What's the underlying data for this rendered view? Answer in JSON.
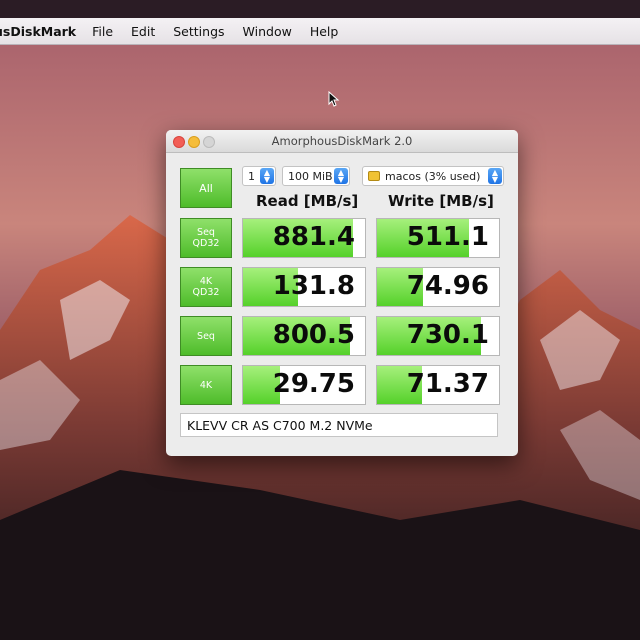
{
  "menubar": {
    "app_name": "usDiskMark",
    "items": [
      "File",
      "Edit",
      "Settings",
      "Window",
      "Help"
    ]
  },
  "window": {
    "title": "AmorphousDiskMark 2.0",
    "all_button": "All",
    "count_select": "1",
    "size_select": "100 MiB",
    "drive_select": "macos (3% used)",
    "read_header": "Read [MB/s]",
    "write_header": "Write [MB/s]",
    "rows": [
      {
        "label1": "Seq",
        "label2": "QD32",
        "read": "881.4",
        "write": "511.1",
        "read_fill": 0.9,
        "write_fill": 0.75
      },
      {
        "label1": "4K",
        "label2": "QD32",
        "read": "131.8",
        "write": "74.96",
        "read_fill": 0.45,
        "write_fill": 0.38
      },
      {
        "label1": "Seq",
        "label2": "",
        "read": "800.5",
        "write": "730.1",
        "read_fill": 0.88,
        "write_fill": 0.85
      },
      {
        "label1": "4K",
        "label2": "",
        "read": "29.75",
        "write": "71.37",
        "read_fill": 0.3,
        "write_fill": 0.37
      }
    ],
    "drive_name": "KLEVV CR AS C700 M.2 NVMe"
  },
  "colors": {
    "accent_green": "#55d12a",
    "button_green": "#4ebc2a"
  },
  "icons": [
    "cursor-arrow-icon",
    "drive-icon",
    "stepper-icon",
    "close-icon",
    "minimize-icon",
    "zoom-icon"
  ]
}
